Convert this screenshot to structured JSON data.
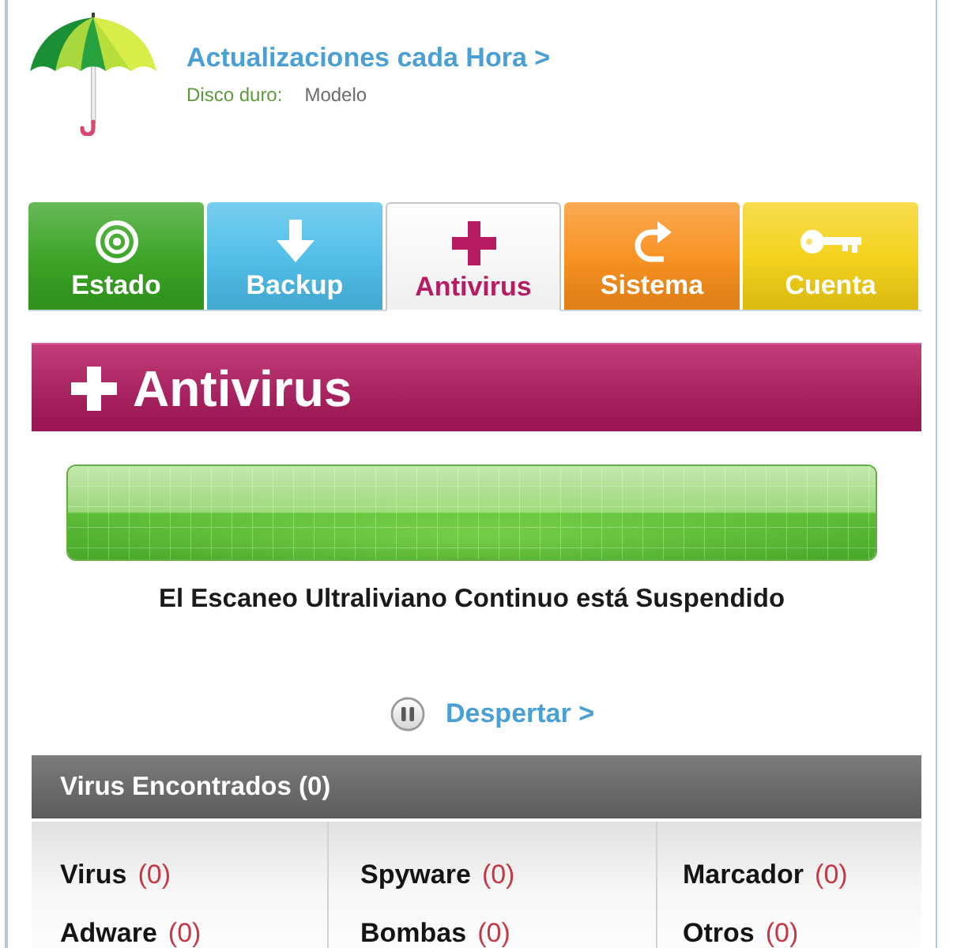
{
  "header": {
    "title": "Actualizaciones cada Hora >",
    "disk_label": "Disco duro:",
    "disk_value": "Modelo"
  },
  "tabs": [
    {
      "label": "Estado",
      "selected": false,
      "color": "#35a21f"
    },
    {
      "label": "Backup",
      "selected": false,
      "color": "#4bbde9"
    },
    {
      "label": "Antivirus",
      "selected": true,
      "color": "#b71c63"
    },
    {
      "label": "Sistema",
      "selected": false,
      "color": "#f98e1a"
    },
    {
      "label": "Cuenta",
      "selected": false,
      "color": "#f4d114"
    }
  ],
  "section": {
    "title": "Antivirus"
  },
  "scan_meter": {
    "level": 1
  },
  "status_message": "El Escaneo Ultraliviano Continuo está Suspendido",
  "wake_link": "Despertar >",
  "found_panel": {
    "title": "Virus Encontrados (0)",
    "items": [
      {
        "label": "Virus",
        "count": "(0)"
      },
      {
        "label": "Spyware",
        "count": "(0)"
      },
      {
        "label": "Marcador",
        "count": "(0)"
      },
      {
        "label": "Adware",
        "count": "(0)"
      },
      {
        "label": "Bombas",
        "count": "(0)"
      },
      {
        "label": "Otros",
        "count": "(0)"
      }
    ]
  }
}
